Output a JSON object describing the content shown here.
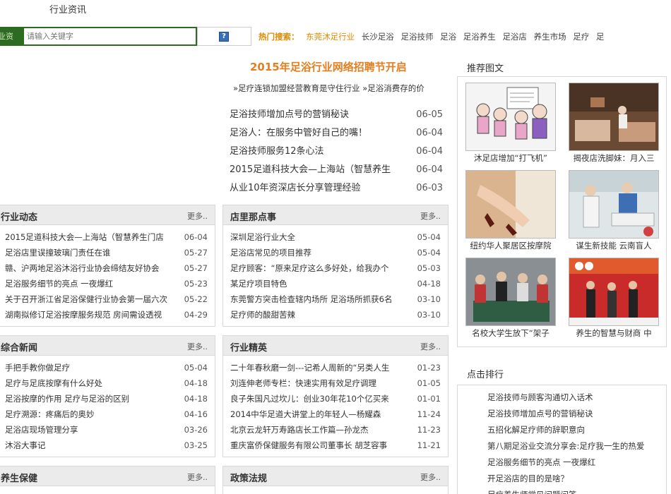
{
  "header": {
    "site_title": "行业资讯"
  },
  "search": {
    "category": "业资",
    "placeholder": "请输入关键字",
    "button_icon": "search-help-icon"
  },
  "hot": {
    "label": "热门搜索：",
    "items": [
      "东莞沐足行业",
      "长沙足浴",
      "足浴技师",
      "足浴",
      "足浴养生",
      "足浴店",
      "养生市场",
      "足疗",
      "足"
    ]
  },
  "headline": "2015年足浴行业网络招聘节开启",
  "sublinks": [
    "»足疗连锁加盟经营教育是守住行业",
    "»足浴消费存的价"
  ],
  "top_news": [
    {
      "title": "足浴技师增加点号的营销秘诀",
      "date": "06-05"
    },
    {
      "title": "足浴人：在服务中管好自己的嘴！",
      "date": "06-04"
    },
    {
      "title": "足浴技师服务12条心法",
      "date": "06-04"
    },
    {
      "title": "2015足道科技大会—上海站（智慧养生",
      "date": "06-04"
    },
    {
      "title": "从业10年资深店长分享管理经验",
      "date": "06-03"
    }
  ],
  "more_label": "更多..",
  "panels": [
    {
      "title": "行业动态",
      "items": [
        {
          "t": "2015足道科技大会—上海站（智慧养生门店",
          "d": "06-04"
        },
        {
          "t": "足浴店里误撞玻璃门责任在谁",
          "d": "05-27"
        },
        {
          "t": "赣、沪两地足浴沐浴行业协会缔结友好协会",
          "d": "05-27"
        },
        {
          "t": "足浴服务细节的亮点 一夜爆红",
          "d": "05-23"
        },
        {
          "t": "关于召开浙江省足浴保健行业协会第一届六次",
          "d": "05-22"
        },
        {
          "t": "湖南拟修订足浴按摩服务规范 房间需设透视",
          "d": "04-29"
        }
      ]
    },
    {
      "title": "店里那点事",
      "items": [
        {
          "t": "深圳足浴行业大全",
          "d": "05-04"
        },
        {
          "t": "足浴店常见的项目推荐",
          "d": "05-04"
        },
        {
          "t": "足疗顾客：“原来足疗这么多好处，给我办个",
          "d": "05-03"
        },
        {
          "t": "某足疗项目特色",
          "d": "04-18"
        },
        {
          "t": "东莞警方突击检查辖内场所 足浴场所抓获6名",
          "d": "03-10"
        },
        {
          "t": "足疗师的酸甜苦辣",
          "d": "03-10"
        }
      ]
    },
    {
      "title": "综合新闻",
      "items": [
        {
          "t": "手把手教你做足疗",
          "d": "05-04"
        },
        {
          "t": "足疗与足底按摩有什么好处",
          "d": "04-18"
        },
        {
          "t": "足浴按摩的作用 足疗与足浴的区别",
          "d": "04-18"
        },
        {
          "t": "足疗溯源：疼痛后的奥妙",
          "d": "04-16"
        },
        {
          "t": "足浴店现场管理分享",
          "d": "03-26"
        },
        {
          "t": "沐浴大事记",
          "d": "03-25"
        }
      ]
    },
    {
      "title": "行业精英",
      "items": [
        {
          "t": "二十年春秋磨一剑---记希人周新的“另类人生",
          "d": "01-23"
        },
        {
          "t": "刘连伸老师专栏：快速实用有效足疗调理",
          "d": "01-05"
        },
        {
          "t": "良子朱国凡过坎儿：创业30年花10个亿买来",
          "d": "01-01"
        },
        {
          "t": "2014中华足道大讲堂上的年轻人—杨耀森",
          "d": "11-24"
        },
        {
          "t": "北京云龙轩万寿路店长工作篇—孙龙杰",
          "d": "11-23"
        },
        {
          "t": "重庆富侨保健服务有限公司董事长 胡芝容事",
          "d": "11-21"
        }
      ]
    },
    {
      "title": "养生保健",
      "items": []
    },
    {
      "title": "政策法规",
      "items": []
    }
  ],
  "recommend": {
    "title": "推荐图文",
    "items": [
      {
        "caption": "沐足店增加“打飞机”"
      },
      {
        "caption": "揭夜店洗脚妹：月入三"
      },
      {
        "caption": "纽约华人聚居区按摩院"
      },
      {
        "caption": "谋生新技能 云南盲人"
      },
      {
        "caption": "名校大学生放下“架子"
      },
      {
        "caption": "养生的智慧与财商 中"
      }
    ]
  },
  "ranking": {
    "title": "点击排行",
    "items": [
      "足浴技师与顾客沟通切入话术",
      "足浴技师增加点号的营销秘诀",
      "五招化解足疗师的辞职意向",
      "第八期足浴业交流分享会:足疗我一生的热爱",
      "足浴服务细节的亮点 一夜爆红",
      "开足浴店的目的是啥？",
      "足疗养生师常见问题问答"
    ]
  }
}
